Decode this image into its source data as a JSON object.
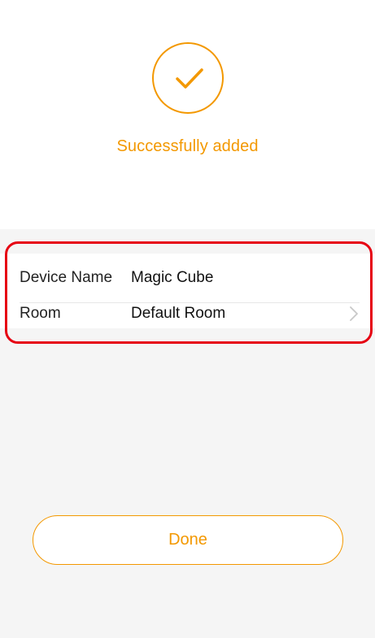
{
  "success": {
    "message": "Successfully added",
    "icon": "checkmark-circle-icon"
  },
  "device_info": {
    "rows": [
      {
        "label": "Device Name",
        "value": "Magic Cube"
      },
      {
        "label": "Room",
        "value": "Default Room",
        "icon": "chevron-right-icon"
      }
    ]
  },
  "actions": {
    "done_label": "Done"
  },
  "colors": {
    "accent": "#f39800",
    "highlight": "#e60012",
    "background": "#f5f5f5"
  }
}
